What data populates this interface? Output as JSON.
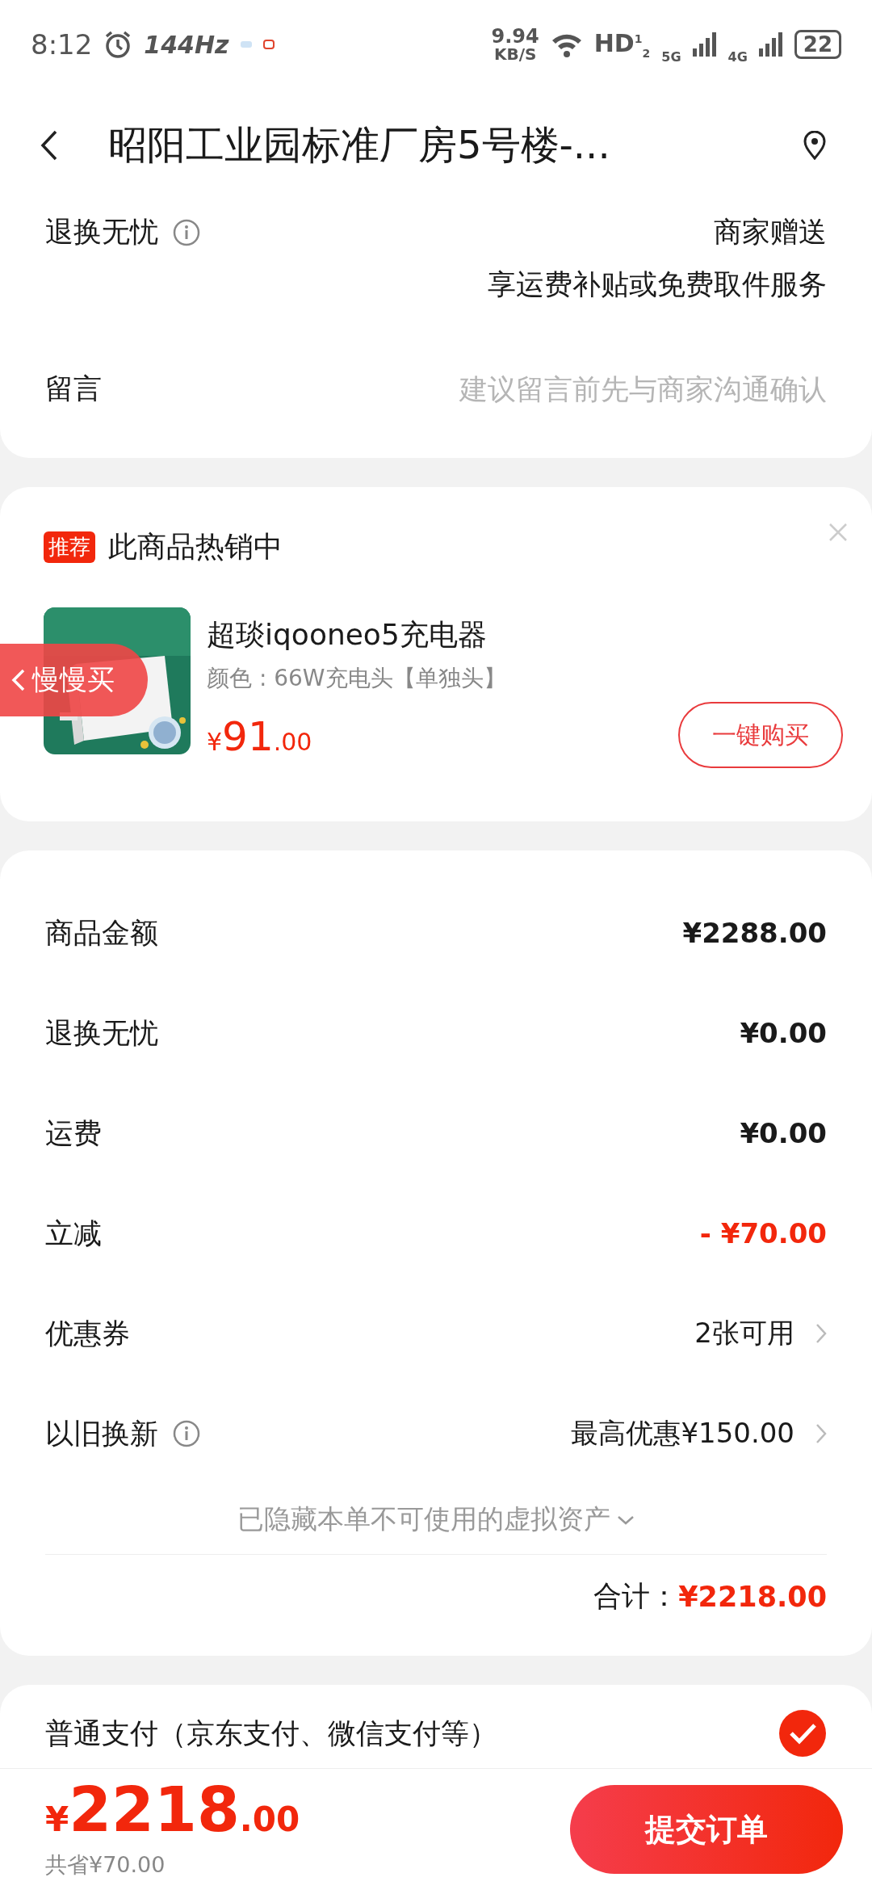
{
  "status_bar": {
    "time": "8:12",
    "refresh": "144Hz",
    "net_speed": "9.94",
    "net_unit": "KB/S",
    "hd": "HD$^{1}$$_{2}$",
    "sim1": "5G",
    "sim2": "4G",
    "battery": "22"
  },
  "header": {
    "title": "昭阳工业园标准厂房5号楼-..."
  },
  "service": {
    "label": "退换无忧",
    "info": true,
    "value_lines": [
      "商家赠送",
      "享运费补贴或免费取件服务"
    ]
  },
  "message": {
    "label": "留言",
    "placeholder": "建议留言前先与商家沟通确认"
  },
  "recommend": {
    "badge": "推荐",
    "title": "此商品热销中",
    "product": {
      "name": "超琰iqooneo5充电器",
      "spec": "颜色 : 66W充电头【单独头】",
      "currency": "¥",
      "price_int": "91",
      "price_dec": ".00",
      "button": "一键购买"
    }
  },
  "float_tab": {
    "label": "慢慢买"
  },
  "summary": {
    "rows": [
      {
        "kind": "amount",
        "label": "商品金额",
        "value": "¥2288.00",
        "info": false
      },
      {
        "kind": "amount",
        "label": "退换无忧",
        "value": "¥0.00",
        "info": false
      },
      {
        "kind": "amount",
        "label": "运费",
        "value": "¥0.00",
        "info": false
      },
      {
        "kind": "discount",
        "label": "立减",
        "value": "- ¥70.00",
        "info": false
      },
      {
        "kind": "link",
        "label": "优惠券",
        "value": "2张可用",
        "info": false
      },
      {
        "kind": "link",
        "label": "以旧换新",
        "value": "最高优惠¥150.00",
        "info": true
      }
    ],
    "hidden_note": "已隐藏本单不可使用的虚拟资产",
    "total_label": "合计：",
    "total_value": "¥2218.00"
  },
  "payment": {
    "label": "普通支付（京东支付、微信支付等）",
    "selected": true
  },
  "bottom_bar": {
    "currency": "¥",
    "price_int": "2218",
    "price_dec": ".00",
    "saved": "共省¥70.00",
    "submit": "提交订单"
  }
}
